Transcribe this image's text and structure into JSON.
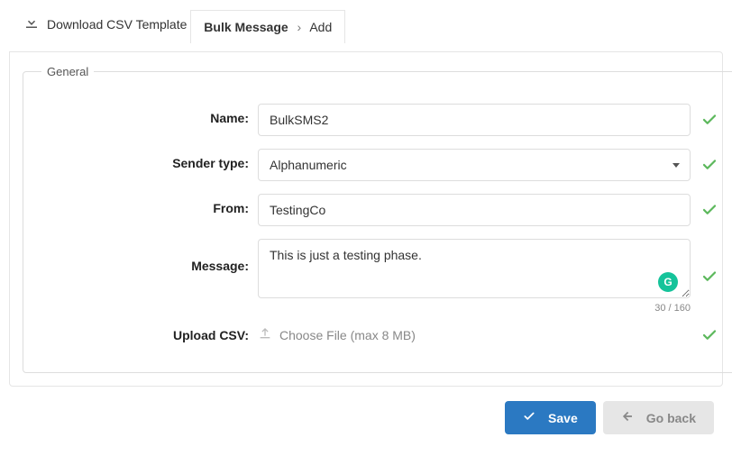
{
  "download_link_label": "Download CSV Template",
  "breadcrumb": {
    "root": "Bulk Message",
    "leaf": "Add"
  },
  "legend": "General",
  "form": {
    "name": {
      "label": "Name:",
      "value": "BulkSMS2"
    },
    "sender_type": {
      "label": "Sender type:",
      "value": "Alphanumeric"
    },
    "from": {
      "label": "From:",
      "value": "TestingCo"
    },
    "message": {
      "label": "Message:",
      "value": "This is just a testing phase.",
      "counter": "30 / 160"
    },
    "upload": {
      "label": "Upload CSV:",
      "button_label": "Choose File (max 8 MB)"
    }
  },
  "buttons": {
    "save": "Save",
    "goback": "Go back"
  },
  "grammarly_letter": "G"
}
